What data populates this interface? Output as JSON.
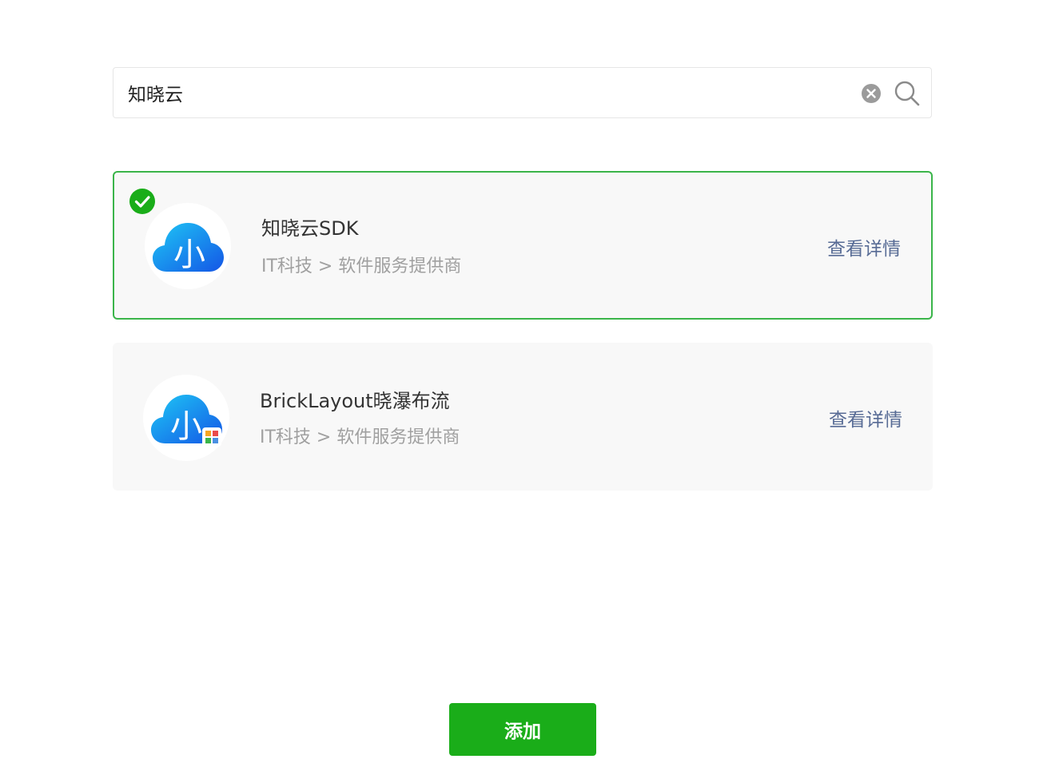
{
  "search": {
    "value": "知晓云",
    "clear_icon": "clear-circle-icon",
    "search_icon": "search-icon"
  },
  "results": [
    {
      "name": "知晓云SDK",
      "category": "IT科技 > 软件服务提供商",
      "detail_label": "查看详情",
      "selected": true,
      "logo_icon": "cloud-xiao-logo",
      "logo_glyph": "小"
    },
    {
      "name": "BrickLayout晓瀑布流",
      "category": "IT科技 > 软件服务提供商",
      "detail_label": "查看详情",
      "selected": false,
      "logo_icon": "cloud-xiao-plugin-logo",
      "logo_glyph": "小"
    }
  ],
  "footer": {
    "add_label": "添加"
  },
  "colors": {
    "accent_green": "#1aad19",
    "selected_border": "#3bb54a",
    "link_blue": "#576b95",
    "muted_text": "#a0a0a0"
  }
}
